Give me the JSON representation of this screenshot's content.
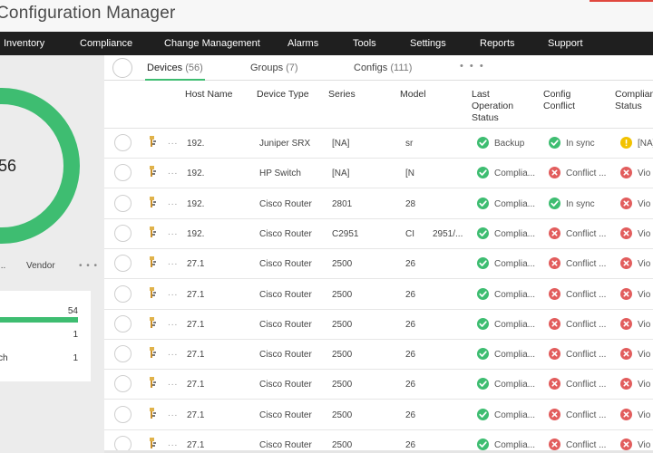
{
  "app": {
    "title": "Configuration Manager"
  },
  "nav": [
    "Inventory",
    "Compliance",
    "Change Management",
    "Alarms",
    "Tools",
    "Settings",
    "Reports",
    "Support"
  ],
  "left": {
    "donut_value": "56",
    "tabs": [
      "...",
      "Vendor",
      "• • •"
    ],
    "stats": [
      {
        "label": "",
        "value": "54",
        "fraction": 0.964
      },
      {
        "label": "",
        "value": "1"
      },
      {
        "label": "ch",
        "value": "1"
      }
    ]
  },
  "tabs": [
    {
      "label": "Devices",
      "count": "(56)"
    },
    {
      "label": "Groups",
      "count": "(7)"
    },
    {
      "label": "Configs",
      "count": "(111)"
    }
  ],
  "tab_more": "• • •",
  "columns": [
    "Host Name",
    "Device Type",
    "Series",
    "Model",
    "Last Operation Status",
    "Config Conflict",
    "Compliance Status"
  ],
  "rows": [
    {
      "host": "192.",
      "type": "Juniper SRX",
      "series": "[NA]",
      "model": "sr",
      "op": "Backup",
      "op_state": "ok",
      "conflict": "In sync",
      "conflict_state": "ok",
      "comp": "[NA]",
      "comp_state": "warn"
    },
    {
      "host": "192.",
      "type": "HP Switch",
      "series": "[NA]",
      "model": "[N",
      "op": "Complia...",
      "op_state": "ok",
      "conflict": "Conflict ...",
      "conflict_state": "err",
      "comp": "Vio",
      "comp_state": "err"
    },
    {
      "host": "192.",
      "type": "Cisco Router",
      "series": "2801",
      "model": "28",
      "op": "Complia...",
      "op_state": "ok",
      "conflict": "In sync",
      "conflict_state": "ok",
      "comp": "Vio",
      "comp_state": "err"
    },
    {
      "host": "192.",
      "type": "Cisco Router",
      "series": "C2951",
      "model": "CI",
      "model_extra": "2951/...",
      "op": "Complia...",
      "op_state": "ok",
      "conflict": "Conflict ...",
      "conflict_state": "err",
      "comp": "Vio",
      "comp_state": "err"
    },
    {
      "host": "27.1",
      "type": "Cisco Router",
      "series": "2500",
      "model": "26",
      "op": "Complia...",
      "op_state": "ok",
      "conflict": "Conflict ...",
      "conflict_state": "err",
      "comp": "Vio",
      "comp_state": "err"
    },
    {
      "host": "27.1",
      "type": "Cisco Router",
      "series": "2500",
      "model": "26",
      "op": "Complia...",
      "op_state": "ok",
      "conflict": "Conflict ...",
      "conflict_state": "err",
      "comp": "Vio",
      "comp_state": "err"
    },
    {
      "host": "27.1",
      "type": "Cisco Router",
      "series": "2500",
      "model": "26",
      "op": "Complia...",
      "op_state": "ok",
      "conflict": "Conflict ...",
      "conflict_state": "err",
      "comp": "Vio",
      "comp_state": "err"
    },
    {
      "host": "27.1",
      "type": "Cisco Router",
      "series": "2500",
      "model": "26",
      "op": "Complia...",
      "op_state": "ok",
      "conflict": "Conflict ...",
      "conflict_state": "err",
      "comp": "Vio",
      "comp_state": "err"
    },
    {
      "host": "27.1",
      "type": "Cisco Router",
      "series": "2500",
      "model": "26",
      "op": "Complia...",
      "op_state": "ok",
      "conflict": "Conflict ...",
      "conflict_state": "err",
      "comp": "Vio",
      "comp_state": "err"
    },
    {
      "host": "27.1",
      "type": "Cisco Router",
      "series": "2500",
      "model": "26",
      "op": "Complia...",
      "op_state": "ok",
      "conflict": "Conflict ...",
      "conflict_state": "err",
      "comp": "Vio",
      "comp_state": "err"
    },
    {
      "host": "27.1",
      "type": "Cisco Router",
      "series": "2500",
      "model": "26",
      "op": "Complia...",
      "op_state": "ok",
      "conflict": "Conflict ...",
      "conflict_state": "err",
      "comp": "Vio",
      "comp_state": "err"
    }
  ],
  "colors": {
    "accent": "#3ebd71",
    "error": "#e25d5d",
    "warning": "#f2c200",
    "nav_bg": "#1f1f1f",
    "top_accent": "#e0483e"
  }
}
